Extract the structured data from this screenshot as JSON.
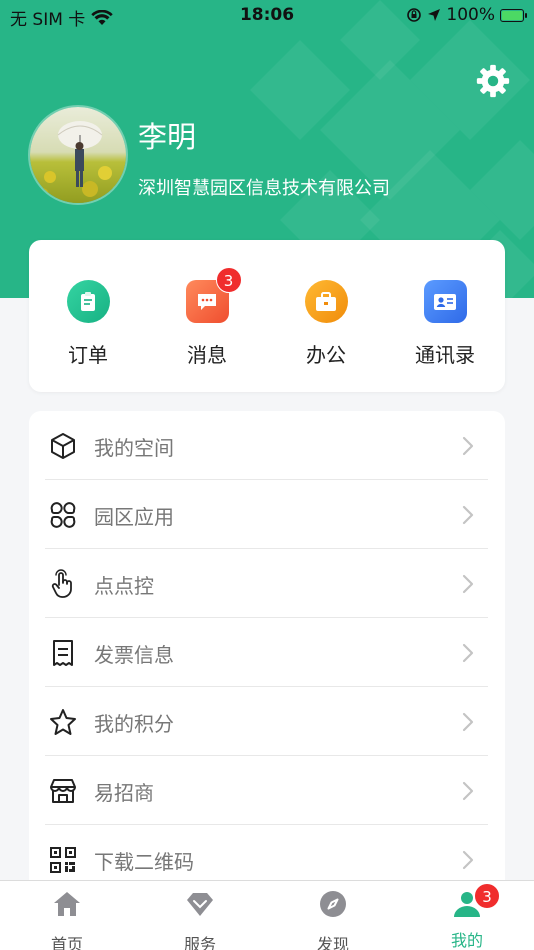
{
  "status_bar": {
    "carrier": "无 SIM 卡",
    "time": "18:06",
    "battery": "100%",
    "battery_level": 1.0
  },
  "profile": {
    "name": "李明",
    "company": "深圳智慧园区信息技术有限公司"
  },
  "quick_actions": [
    {
      "label": "订单",
      "icon": "order-icon",
      "color": "#1fbe8f"
    },
    {
      "label": "消息",
      "icon": "message-icon",
      "color": "#f4623a",
      "badge": "3"
    },
    {
      "label": "办公",
      "icon": "briefcase-icon",
      "color": "#f7a011"
    },
    {
      "label": "通讯录",
      "icon": "contact-card-icon",
      "color": "#3c7cf0"
    }
  ],
  "menu": [
    {
      "label": "我的空间",
      "icon": "cube-icon"
    },
    {
      "label": "园区应用",
      "icon": "apps-grid-icon"
    },
    {
      "label": "点点控",
      "icon": "touch-hand-icon"
    },
    {
      "label": "发票信息",
      "icon": "invoice-icon"
    },
    {
      "label": "我的积分",
      "icon": "star-icon"
    },
    {
      "label": "易招商",
      "icon": "storefront-icon"
    },
    {
      "label": "下载二维码",
      "icon": "qrcode-icon"
    }
  ],
  "tabbar": [
    {
      "label": "首页",
      "icon": "home-icon"
    },
    {
      "label": "服务",
      "icon": "diamond-icon"
    },
    {
      "label": "发现",
      "icon": "compass-icon"
    },
    {
      "label": "我的",
      "icon": "user-icon",
      "badge": "3",
      "active": true
    }
  ],
  "colors": {
    "brand": "#27b587",
    "badge": "#f02d2d",
    "background": "#f5f6f8"
  }
}
